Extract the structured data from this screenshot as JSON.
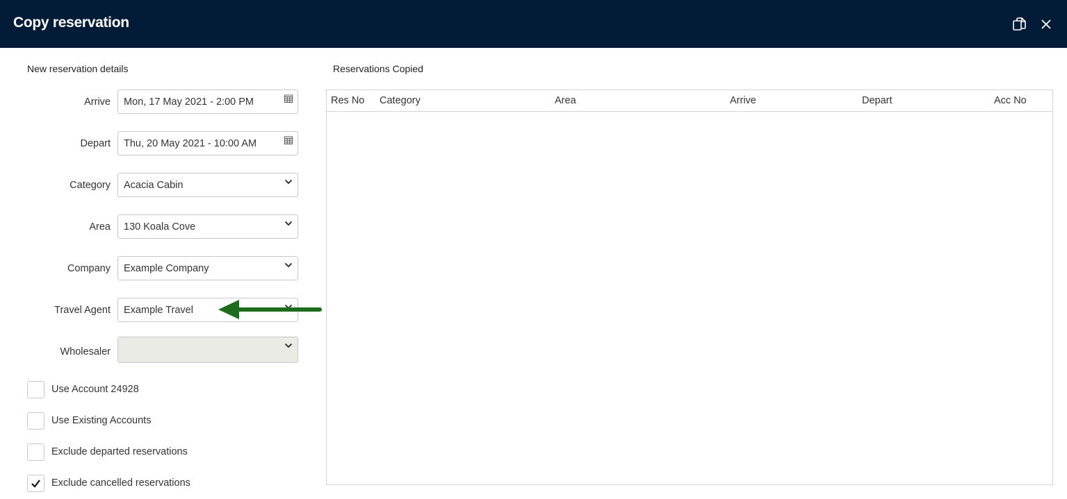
{
  "window": {
    "title": "Copy reservation",
    "icons": {
      "duplicate": "duplicate-icon",
      "close": "close-icon"
    },
    "header_color": "#021b36"
  },
  "form": {
    "section_title": "New reservation details",
    "fields": {
      "arrive": {
        "label": "Arrive",
        "value": "Mon, 17 May 2021 - 2:00 PM",
        "icon": "calendar-icon"
      },
      "depart": {
        "label": "Depart",
        "value": "Thu, 20 May 2021 - 10:00 AM",
        "icon": "calendar-icon"
      },
      "category": {
        "label": "Category",
        "value": "Acacia Cabin",
        "icon": "chevron-down-icon"
      },
      "area": {
        "label": "Area",
        "value": "130 Koala Cove",
        "icon": "chevron-down-icon"
      },
      "company": {
        "label": "Company",
        "value": "Example Company",
        "icon": "chevron-down-icon"
      },
      "travel_agent": {
        "label": "Travel Agent",
        "value": "Example Travel",
        "icon": "chevron-down-icon"
      },
      "wholesaler": {
        "label": "Wholesaler",
        "value": "",
        "icon": "chevron-down-icon"
      }
    },
    "checkboxes": [
      {
        "label": "Use Account 24928",
        "checked": false
      },
      {
        "label": "Use Existing Accounts",
        "checked": false
      },
      {
        "label": "Exclude departed reservations",
        "checked": false
      },
      {
        "label": "Exclude cancelled reservations",
        "checked": true
      }
    ]
  },
  "copied": {
    "section_title": "Reservations Copied",
    "columns": [
      "Res No",
      "Category",
      "Area",
      "Arrive",
      "Depart",
      "Acc No"
    ],
    "rows": []
  },
  "annotation": {
    "arrow_color": "#1e6b1e",
    "icon": "arrow-left-icon"
  }
}
